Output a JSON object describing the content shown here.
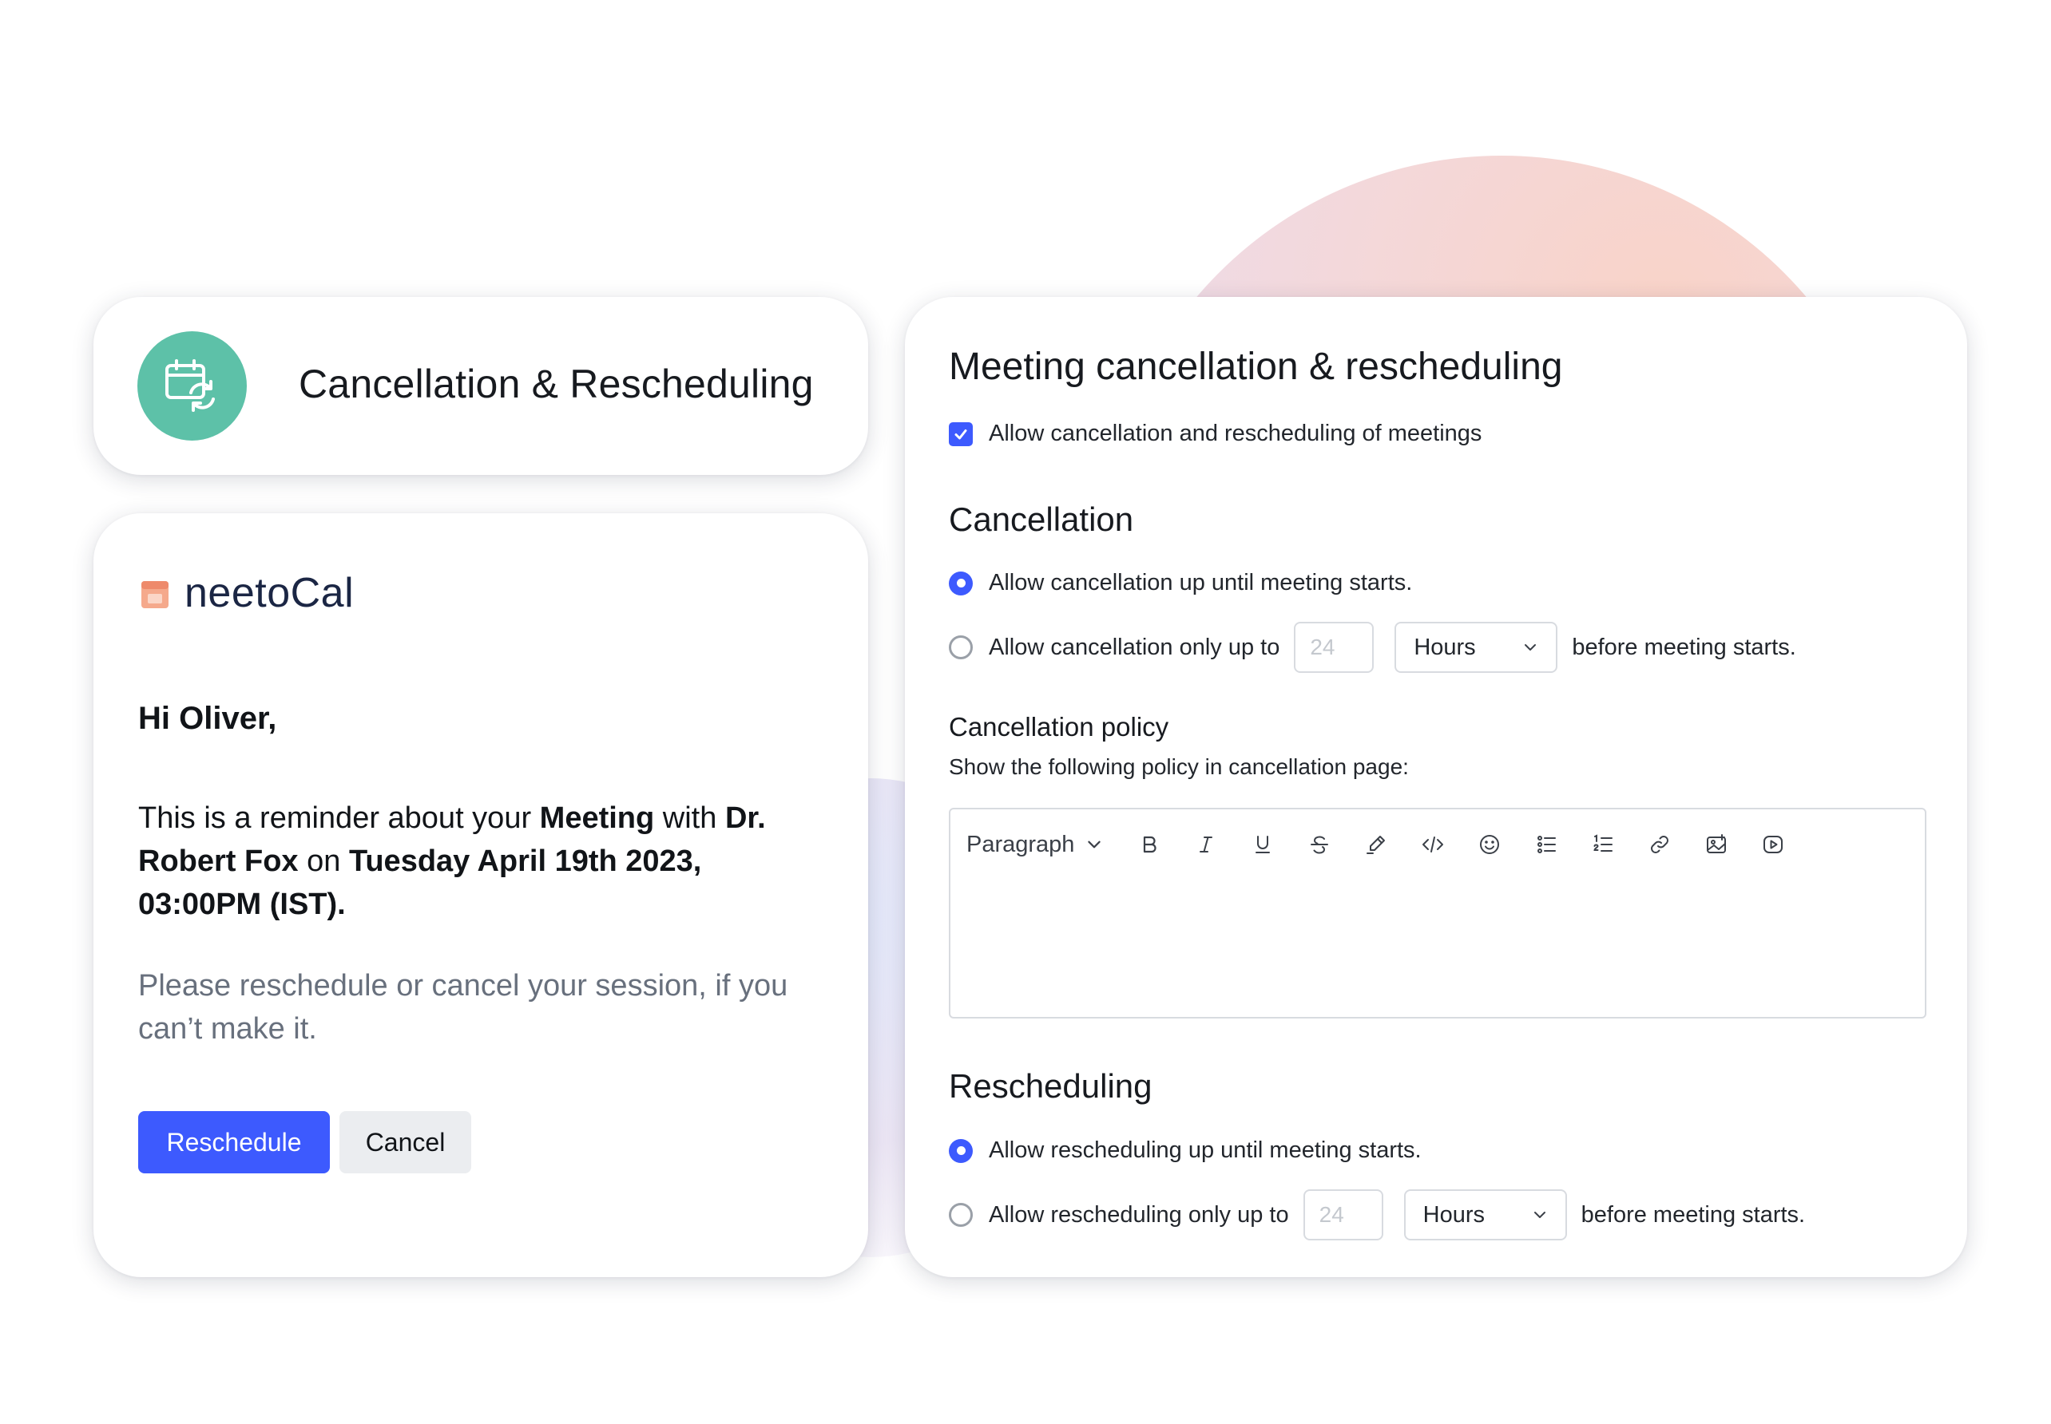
{
  "header_card": {
    "title": "Cancellation & Rescheduling",
    "icon": "calendar-sync-icon",
    "icon_color": "#5dc1a8"
  },
  "email_card": {
    "logo_text": "neetoCal",
    "greeting": "Hi Oliver,",
    "reminder": {
      "part1": "This is a reminder about your ",
      "meeting": "Meeting",
      "part2": " with ",
      "person": "Dr. Robert Fox",
      "part3": " on ",
      "datetime": "Tuesday April 19th 2023, 03:00PM (IST)",
      "part4": "."
    },
    "please_text": "Please reschedule or cancel your session, if you can’t make it.",
    "reschedule_button": "Reschedule",
    "cancel_button": "Cancel",
    "accent_color": "#3d5afe"
  },
  "settings": {
    "title": "Meeting cancellation & rescheduling",
    "allow_checkbox_label": "Allow cancellation and rescheduling of meetings",
    "allow_checked": true,
    "cancellation": {
      "heading": "Cancellation",
      "option_until": "Allow cancellation up until meeting starts.",
      "option_limited_prefix": "Allow cancellation only up to",
      "option_limited_suffix": "before meeting starts.",
      "value_placeholder": "24",
      "unit": "Hours",
      "selected": "until"
    },
    "policy": {
      "heading": "Cancellation policy",
      "subtext": "Show the following policy in cancellation page:",
      "format_dropdown": "Paragraph",
      "toolbar_icons": [
        "bold-icon",
        "italic-icon",
        "underline-icon",
        "strikethrough-icon",
        "highlight-icon",
        "code-icon",
        "emoji-icon",
        "bullet-list-icon",
        "numbered-list-icon",
        "link-icon",
        "image-icon",
        "video-icon"
      ]
    },
    "rescheduling": {
      "heading": "Rescheduling",
      "option_until": "Allow rescheduling up until meeting starts.",
      "option_limited_prefix": "Allow rescheduling only up to",
      "option_limited_suffix": "before meeting starts.",
      "value_placeholder": "24",
      "unit": "Hours",
      "selected": "until"
    }
  }
}
